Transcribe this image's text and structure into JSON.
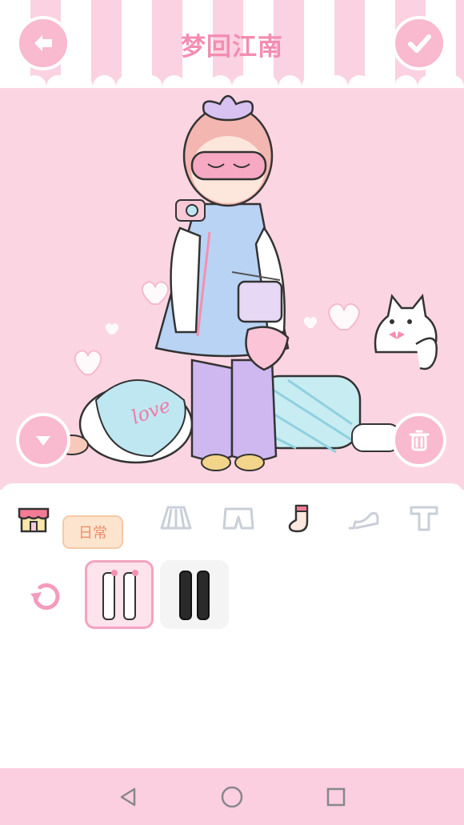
{
  "header": {
    "title": "梦回江南"
  },
  "buttons": {
    "back_icon": "arrow-left-icon",
    "confirm_icon": "checkmark-icon",
    "collapse_icon": "chevron-down-icon",
    "delete_icon": "trash-icon"
  },
  "categories": {
    "shop_icon": "shop-icon",
    "tag_label": "日常",
    "items": [
      "skirt-icon",
      "shorts-icon",
      "sock-icon",
      "high-heel-icon",
      "top-icon"
    ],
    "active": "sock-icon"
  },
  "items": {
    "reset_icon": "refresh-icon",
    "options": [
      {
        "name": "white-stockings",
        "selected": true
      },
      {
        "name": "black-stockings",
        "selected": false
      }
    ]
  },
  "navbar": [
    "back-triangle-icon",
    "home-circle-icon",
    "recents-square-icon"
  ],
  "colors": {
    "pink_bg": "#fcd5e3",
    "accent": "#f48db0",
    "button": "#f9b9cf",
    "tag_bg": "#fde4cf",
    "tag_text": "#ec8f6b"
  }
}
